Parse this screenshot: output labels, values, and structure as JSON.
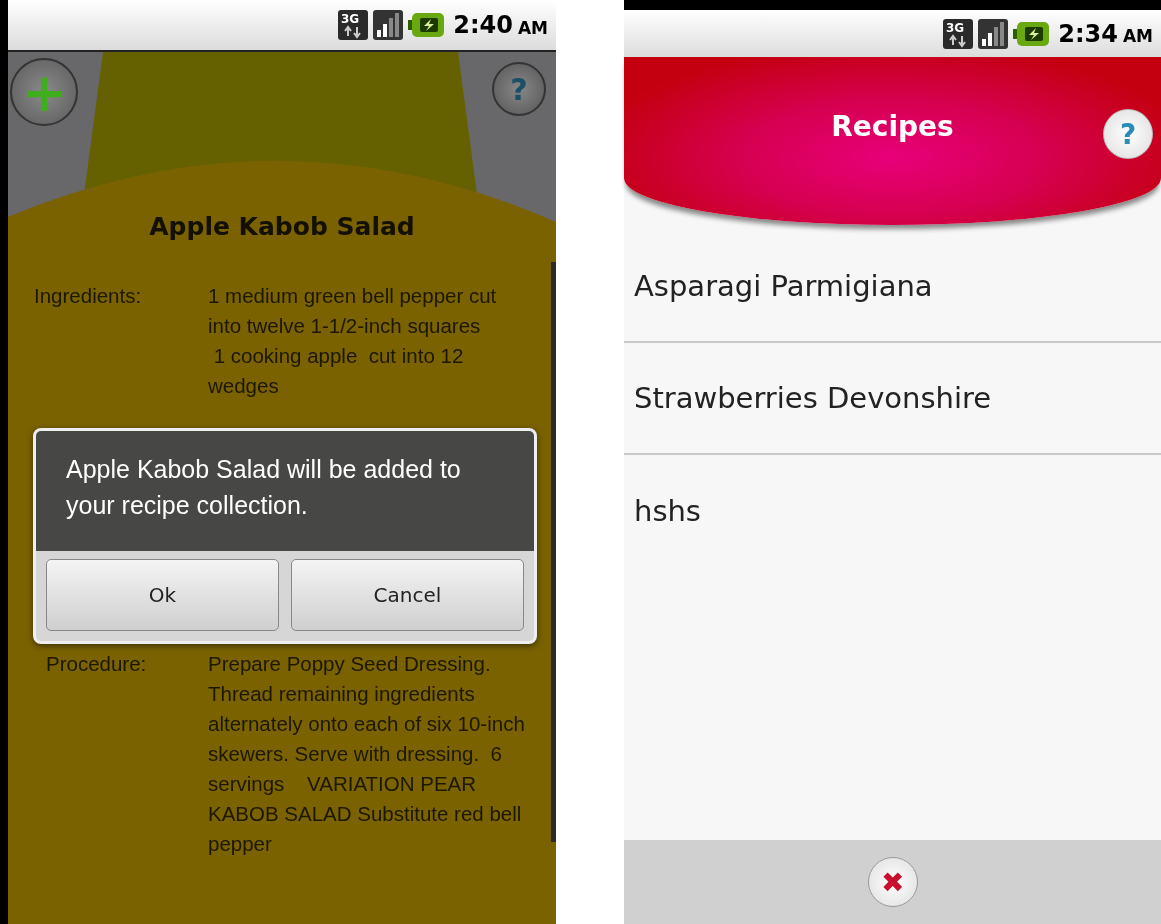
{
  "recipe_screen": {
    "status_bar": {
      "network": "3G",
      "time": "2:40",
      "meridiem": "AM"
    },
    "add_button": {
      "label": "+"
    },
    "help_button": {
      "label": "?"
    },
    "title": "Apple Kabob Salad",
    "ingredients": {
      "label": "Ingredients:",
      "lines": [
        "1 medium green bell pepper cut into twelve 1-1/2-inch squares",
        " 1 cooking apple  cut into 12 wedges"
      ]
    },
    "procedure": {
      "label": "Procedure:",
      "text": "Prepare Poppy Seed Dressing. Thread remaining ingredients alternately onto each of six 10-inch skewers. Serve with dressing.  6 servings    VARIATION PEAR KABOB SALAD Substitute red bell pepper"
    },
    "dialog": {
      "message": "Apple Kabob Salad will be added to your recipe collection.",
      "buttons": [
        "Ok",
        "Cancel"
      ]
    }
  },
  "recipes_screen": {
    "status_bar": {
      "network": "3G",
      "time": "2:34",
      "meridiem": "AM"
    },
    "title": "Recipes",
    "help_button": {
      "label": "?"
    },
    "recipes": [
      "Asparagi Parmigiana",
      "Strawberries Devonshire",
      "hshs"
    ],
    "close_button": {
      "label": "✖"
    }
  }
}
